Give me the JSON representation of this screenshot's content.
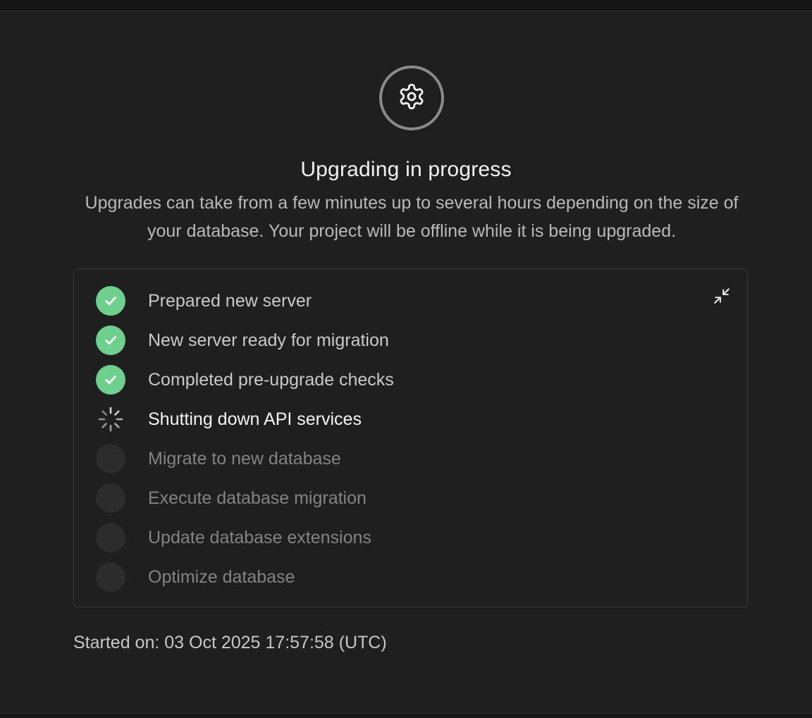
{
  "header": {
    "title": "Upgrading in progress",
    "description": "Upgrades can take from a few minutes up to several hours depending on the size of your database. Your project will be offline while it is being upgraded."
  },
  "steps": [
    {
      "label": "Prepared new server",
      "status": "done"
    },
    {
      "label": "New server ready for migration",
      "status": "done"
    },
    {
      "label": "Completed pre-upgrade checks",
      "status": "done"
    },
    {
      "label": "Shutting down API services",
      "status": "in-progress"
    },
    {
      "label": "Migrate to new database",
      "status": "pending"
    },
    {
      "label": "Execute database migration",
      "status": "pending"
    },
    {
      "label": "Update database extensions",
      "status": "pending"
    },
    {
      "label": "Optimize database",
      "status": "pending"
    }
  ],
  "footer": {
    "started_on": "Started on: 03 Oct 2025 17:57:58 (UTC)"
  },
  "icons": {
    "header": "gear-icon",
    "collapse": "collapse-arrows-icon",
    "done": "check-icon",
    "in_progress": "spinner-icon"
  },
  "colors": {
    "background": "#1f1f1f",
    "success": "#6fcf8f",
    "pending": "#2c2c2c",
    "border": "#383838"
  }
}
